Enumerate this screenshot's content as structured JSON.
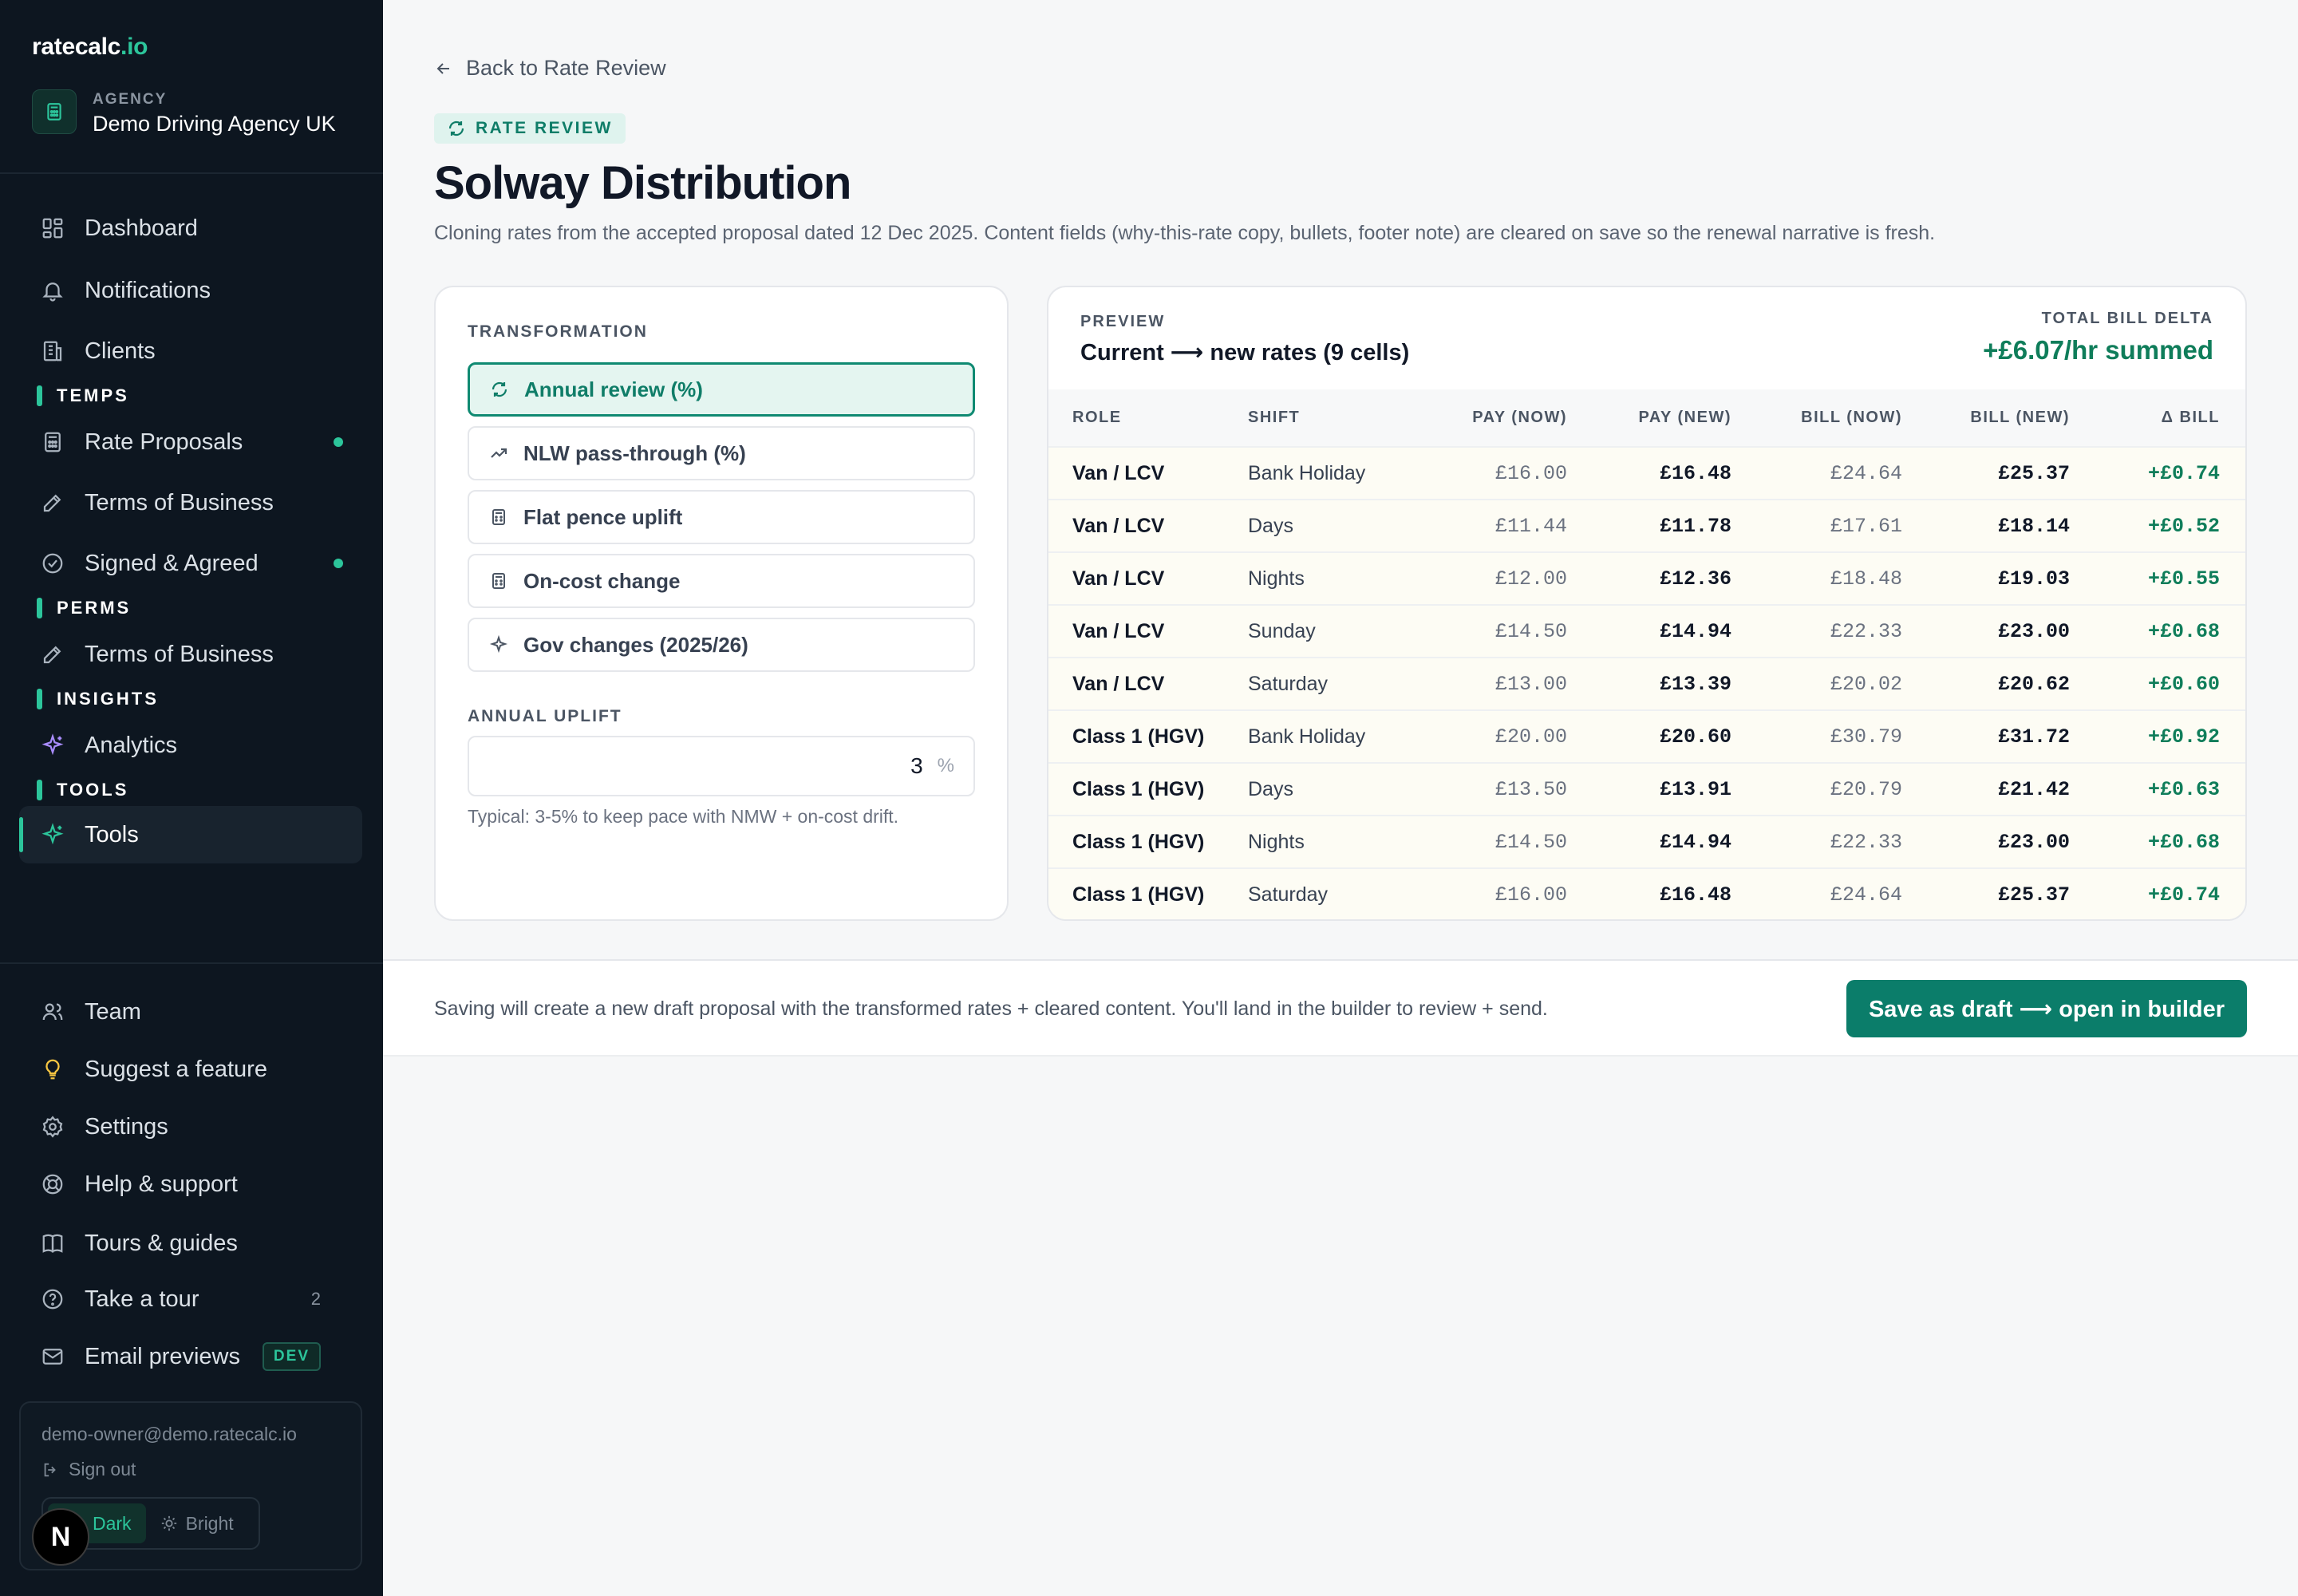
{
  "brand": {
    "name": "ratecalc",
    "tld": ".io"
  },
  "agency": {
    "kicker": "AGENCY",
    "name": "Demo Driving Agency UK"
  },
  "nav": {
    "top": [
      {
        "label": "Dashboard",
        "icon": "grid-icon"
      },
      {
        "label": "Notifications",
        "icon": "bell-icon"
      },
      {
        "label": "Clients",
        "icon": "building-icon"
      }
    ],
    "temps_label": "TEMPS",
    "temps": [
      {
        "label": "Rate Proposals",
        "icon": "calculator-icon",
        "dot": true
      },
      {
        "label": "Terms of Business",
        "icon": "pen-icon"
      },
      {
        "label": "Signed & Agreed",
        "icon": "check-circle-icon",
        "dot": true
      }
    ],
    "perms_label": "PERMS",
    "perms": [
      {
        "label": "Terms of Business",
        "icon": "pen-icon"
      }
    ],
    "insights_label": "INSIGHTS",
    "insights": [
      {
        "label": "Analytics",
        "icon": "sparkle-icon"
      }
    ],
    "tools_label": "TOOLS",
    "tools": [
      {
        "label": "Tools",
        "icon": "sparkle-icon",
        "active": true
      }
    ],
    "bottom": [
      {
        "label": "Team",
        "icon": "users-icon"
      },
      {
        "label": "Suggest a feature",
        "icon": "lightbulb-icon"
      },
      {
        "label": "Settings",
        "icon": "gear-icon"
      },
      {
        "label": "Help & support",
        "icon": "lifebuoy-icon"
      },
      {
        "label": "Tours & guides",
        "icon": "book-icon"
      },
      {
        "label": "Take a tour",
        "icon": "help-circle-icon",
        "count": "2"
      },
      {
        "label": "Email previews",
        "icon": "mail-icon",
        "badge": "DEV"
      }
    ]
  },
  "user": {
    "email": "demo-owner@demo.ratecalc.io",
    "signout": "Sign out",
    "theme_dark": "Dark",
    "theme_bright": "Bright",
    "n_badge": "N"
  },
  "main": {
    "back": "Back to Rate Review",
    "kicker": "RATE REVIEW",
    "title": "Solway Distribution",
    "subtitle": "Cloning rates from the accepted proposal dated 12 Dec 2025. Content fields (why-this-rate copy, bullets, footer note) are cleared on save so the renewal narrative is fresh."
  },
  "transform": {
    "label": "TRANSFORMATION",
    "options": [
      {
        "label": "Annual review (%)",
        "icon": "refresh-icon",
        "selected": true
      },
      {
        "label": "NLW pass-through (%)",
        "icon": "trend-up-icon"
      },
      {
        "label": "Flat pence uplift",
        "icon": "calculator-icon"
      },
      {
        "label": "On-cost change",
        "icon": "calculator-icon"
      },
      {
        "label": "Gov changes (2025/26)",
        "icon": "sparkle-icon"
      }
    ],
    "uplift_label": "ANNUAL UPLIFT",
    "uplift_value": "3",
    "uplift_unit": "%",
    "hint": "Typical: 3-5% to keep pace with NMW + on-cost drift."
  },
  "preview": {
    "kicker": "PREVIEW",
    "title": "Current ⟶ new rates (9 cells)",
    "delta_label": "TOTAL BILL DELTA",
    "delta_value": "+£6.07/hr summed",
    "columns": [
      "ROLE",
      "SHIFT",
      "PAY (NOW)",
      "PAY (NEW)",
      "BILL (NOW)",
      "BILL (NEW)",
      "Δ BILL"
    ],
    "rows": [
      [
        "Van / LCV",
        "Bank Holiday",
        "£16.00",
        "£16.48",
        "£24.64",
        "£25.37",
        "+£0.74"
      ],
      [
        "Van / LCV",
        "Days",
        "£11.44",
        "£11.78",
        "£17.61",
        "£18.14",
        "+£0.52"
      ],
      [
        "Van / LCV",
        "Nights",
        "£12.00",
        "£12.36",
        "£18.48",
        "£19.03",
        "+£0.55"
      ],
      [
        "Van / LCV",
        "Sunday",
        "£14.50",
        "£14.94",
        "£22.33",
        "£23.00",
        "+£0.68"
      ],
      [
        "Van / LCV",
        "Saturday",
        "£13.00",
        "£13.39",
        "£20.02",
        "£20.62",
        "+£0.60"
      ],
      [
        "Class 1 (HGV)",
        "Bank Holiday",
        "£20.00",
        "£20.60",
        "£30.79",
        "£31.72",
        "+£0.92"
      ],
      [
        "Class 1 (HGV)",
        "Days",
        "£13.50",
        "£13.91",
        "£20.79",
        "£21.42",
        "+£0.63"
      ],
      [
        "Class 1 (HGV)",
        "Nights",
        "£14.50",
        "£14.94",
        "£22.33",
        "£23.00",
        "+£0.68"
      ],
      [
        "Class 1 (HGV)",
        "Saturday",
        "£16.00",
        "£16.48",
        "£24.64",
        "£25.37",
        "+£0.74"
      ]
    ]
  },
  "footer": {
    "text": "Saving will create a new draft proposal with the transformed rates + cleared content. You'll land in the builder to review + send.",
    "cta": "Save as draft ⟶ open in builder"
  },
  "colors": {
    "accent": "#0b7d6a",
    "sidebar_bg": "#0d1620",
    "positive": "#0f7d5a"
  }
}
